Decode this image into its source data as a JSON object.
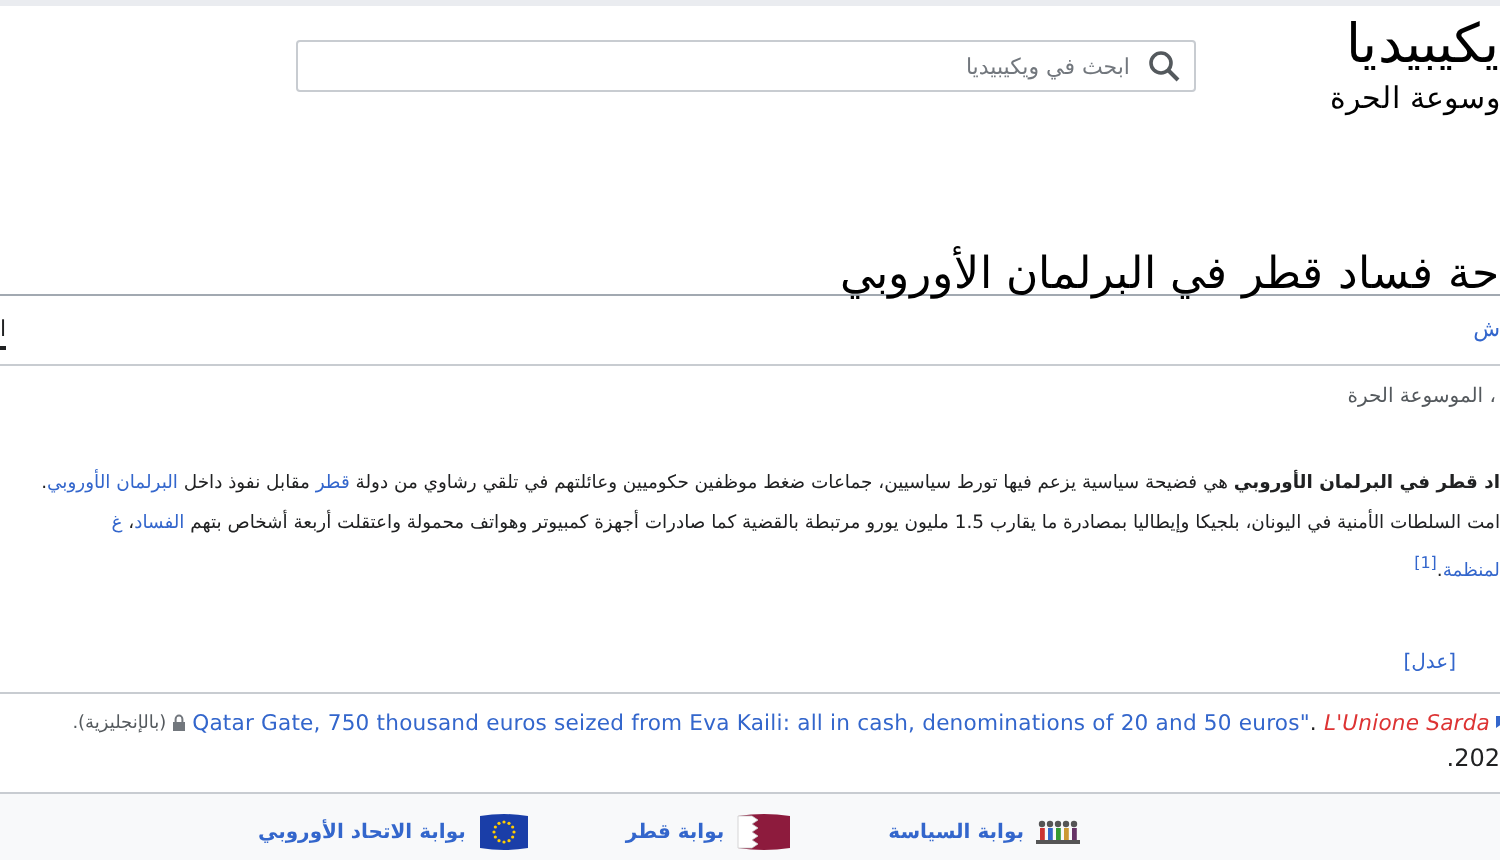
{
  "header": {
    "logo_title": "يكيبيديا",
    "logo_tagline": "وسوعة الحرة",
    "search": {
      "placeholder": "ابحث في ويكيبيديا"
    }
  },
  "page_title": "حة فساد قطر في البرلمان الأوروبي",
  "tabs": [
    {
      "label": "ش",
      "selected": false
    },
    {
      "label": "ا",
      "selected": true
    }
  ],
  "site_sub": "، الموسوعة الحرة",
  "lead_lines": [
    [
      {
        "kind": "bold",
        "text": "اد قطر في البرلمان الأوروبي"
      },
      {
        "kind": "plain",
        "text": " هي فضيحة سياسية يزعم فيها تورط سياسيين، جماعات ضغط موظفين حكوميين وعائلتهم في تلقي رشاوي من دولة "
      },
      {
        "kind": "link",
        "text": "قطر"
      },
      {
        "kind": "plain",
        "text": " مقابل نفوذ داخل "
      },
      {
        "kind": "link",
        "text": "البرلمان الأوروبي"
      },
      {
        "kind": "plain",
        "text": "."
      }
    ],
    [
      {
        "kind": "plain",
        "text": "امت السلطات الأمنية في اليونان، بلجيكا وإيطاليا بمصادرة ما يقارب 1.5 مليون يورو مرتبطة بالقضية كما صادرات أجهزة كمبيوتر وهواتف محمولة واعتقلت أربعة أشخاص بتهم "
      },
      {
        "kind": "link",
        "text": "الفساد"
      },
      {
        "kind": "plain",
        "text": "، "
      },
      {
        "kind": "link",
        "text": "غ"
      }
    ],
    [
      {
        "kind": "link",
        "text": "لمنظمة"
      },
      {
        "kind": "plain",
        "text": "."
      },
      {
        "kind": "ref",
        "text": "[1]"
      }
    ]
  ],
  "edit_link": "[عدل]",
  "reference": {
    "source": "L'Unione Sarda",
    "separator": ". ",
    "title": "Qatar Gate, 750 thousand euros seized from Eva Kaili: all in cash, denominations of 20 and 50 euros\"",
    "language": "(بالإنجليزية).",
    "date": "202."
  },
  "portals": [
    {
      "label": "بوابة السياسة",
      "kind": "politics"
    },
    {
      "label": "بوابة قطر",
      "kind": "qatar"
    },
    {
      "label": "بوابة الاتحاد الأوروبي",
      "kind": "eu"
    }
  ]
}
